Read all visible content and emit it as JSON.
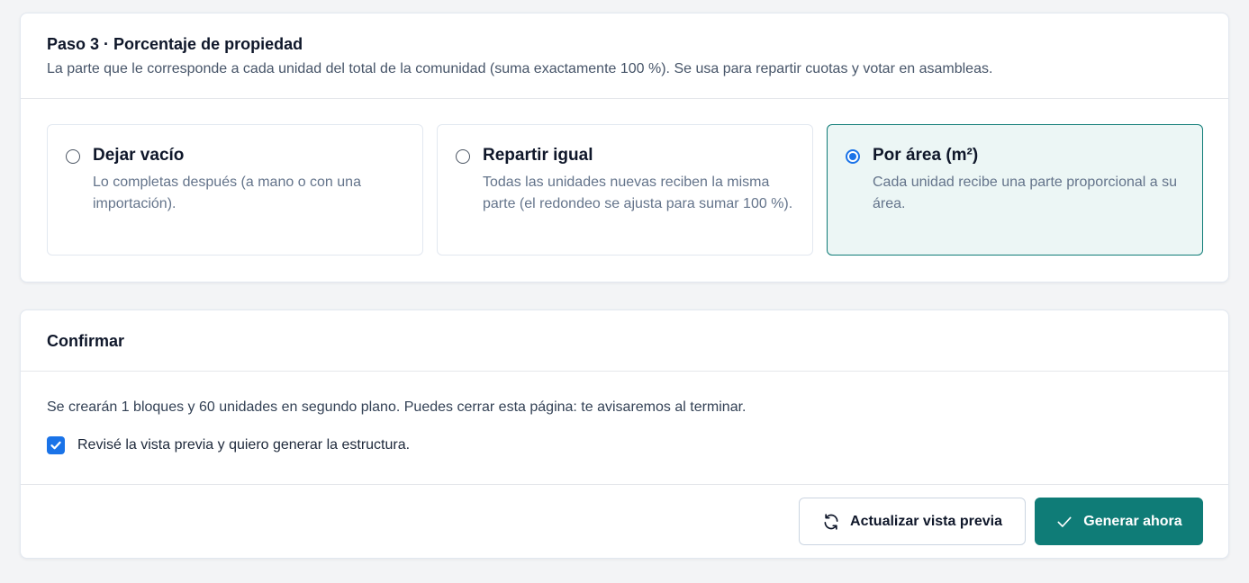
{
  "step3": {
    "title": "Paso 3 · Porcentaje de propiedad",
    "subtitle": "La parte que le corresponde a cada unidad del total de la comunidad (suma exactamente 100 %). Se usa para repartir cuotas y votar en asambleas.",
    "options": [
      {
        "title": "Dejar vacío",
        "description": "Lo completas después (a mano o con una importación).",
        "selected": false
      },
      {
        "title": "Repartir igual",
        "description": "Todas las unidades nuevas reciben la misma parte (el redondeo se ajusta para sumar 100 %).",
        "selected": false
      },
      {
        "title": "Por área (m²)",
        "description": "Cada unidad recibe una parte proporcional a su área.",
        "selected": true
      }
    ]
  },
  "confirm": {
    "title": "Confirmar",
    "message": "Se crearán 1 bloques y 60 unidades en segundo plano. Puedes cerrar esta página: te avisaremos al terminar.",
    "checkbox_label": "Revisé la vista previa y quiero generar la estructura.",
    "checkbox_checked": true,
    "refresh_button": "Actualizar vista previa",
    "generate_button": "Generar ahora"
  },
  "colors": {
    "accent": "#0f7c77",
    "selected_bg": "#ecf6f5",
    "control_blue": "#1a73e8"
  },
  "icons": {
    "refresh": "refresh-icon",
    "check": "check-icon"
  }
}
